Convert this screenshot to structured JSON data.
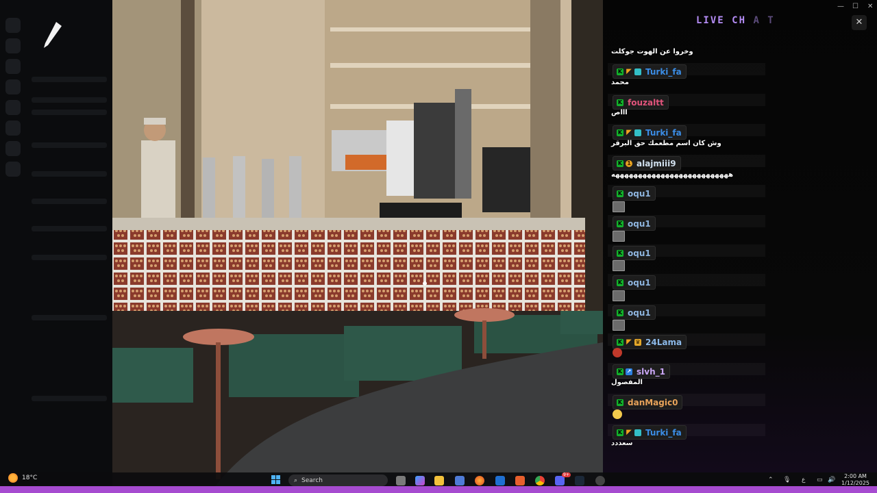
{
  "overlay": {
    "title_main": "LIVE CH",
    "title_fade": "A T"
  },
  "window_controls": {
    "minimize": "—",
    "maximize": "☐",
    "close": "✕"
  },
  "chat_messages": [
    {
      "type": "text",
      "text": "وخروا عن الهوت جوكلت"
    },
    {
      "type": "user",
      "username": "Turki_fa",
      "color": "#3b8de6",
      "badges": [
        "k",
        "gold",
        "teal"
      ]
    },
    {
      "type": "text",
      "text": "محمد"
    },
    {
      "type": "user",
      "username": "fouzaltt",
      "color": "#e2547c",
      "badges": [
        "k"
      ]
    },
    {
      "type": "text",
      "text": "اااص"
    },
    {
      "type": "user",
      "username": "Turki_fa",
      "color": "#3b8de6",
      "badges": [
        "k",
        "gold",
        "teal"
      ]
    },
    {
      "type": "text",
      "text": "وش كان اسم مطعمك حق البرقر"
    },
    {
      "type": "user",
      "username": "alajmiii9",
      "color": "#d1e0ee",
      "badges": [
        "k",
        "circle"
      ]
    },
    {
      "type": "text",
      "text": "ههههههههههههههههههههههههههه"
    },
    {
      "type": "user",
      "username": "oqu1",
      "color": "#8fb6e0",
      "badges": [
        "k"
      ]
    },
    {
      "type": "emote"
    },
    {
      "type": "user",
      "username": "oqu1",
      "color": "#8fb6e0",
      "badges": [
        "k"
      ]
    },
    {
      "type": "emote"
    },
    {
      "type": "user",
      "username": "oqu1",
      "color": "#8fb6e0",
      "badges": [
        "k"
      ]
    },
    {
      "type": "emote"
    },
    {
      "type": "user",
      "username": "oqu1",
      "color": "#8fb6e0",
      "badges": [
        "k"
      ]
    },
    {
      "type": "emote"
    },
    {
      "type": "user",
      "username": "oqu1",
      "color": "#8fb6e0",
      "badges": [
        "k"
      ]
    },
    {
      "type": "emote"
    },
    {
      "type": "user",
      "username": "24Lama",
      "color": "#8cb9e8",
      "badges": [
        "k",
        "gold",
        "crown"
      ]
    },
    {
      "type": "emoji",
      "color": "#c0392b"
    },
    {
      "type": "user",
      "username": "slvh_1",
      "color": "#c9a6f5",
      "badges": [
        "k",
        "blue"
      ]
    },
    {
      "type": "text",
      "text": "المفصول"
    },
    {
      "type": "user",
      "username": "danMagic0",
      "color": "#e7a35a",
      "badges": [
        "k"
      ]
    },
    {
      "type": "emoji",
      "color": "#f2c94c"
    },
    {
      "type": "user",
      "username": "Turki_fa",
      "color": "#3b8de6",
      "badges": [
        "k",
        "gold",
        "teal"
      ]
    },
    {
      "type": "text",
      "text": "سعددد"
    }
  ],
  "taskbar": {
    "search_placeholder": "Search",
    "weather_temp": "18°C",
    "time": "2:00 AM",
    "date": "1/12/2025",
    "lang": "ع",
    "notification_badge": "9+"
  }
}
